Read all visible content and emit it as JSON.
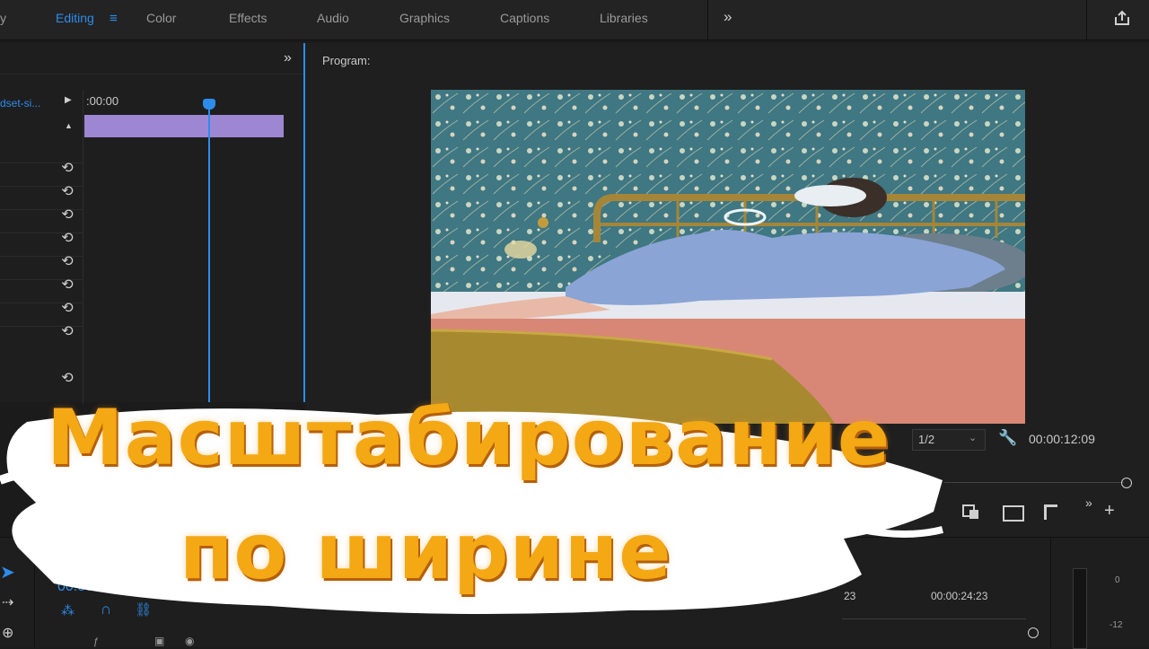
{
  "workspaces": {
    "partial_left": "y",
    "tabs": [
      "Editing",
      "Color",
      "Effects",
      "Audio",
      "Graphics",
      "Captions",
      "Libraries"
    ],
    "active": "Editing",
    "more": "»"
  },
  "effect_controls": {
    "clip_name": "dset-si...",
    "time_start": ":00:00"
  },
  "program": {
    "title": "Program:",
    "resolution": "1/2",
    "timecode": "00:00:12:09"
  },
  "timeline": {
    "playhead": "00:00:",
    "ruler_a": "23",
    "ruler_b": "00:00:24:23"
  },
  "audio_meter": {
    "db_top": "0",
    "db_mid": "-12"
  },
  "overlay": {
    "line1": "Масштабирование",
    "line2": "по ширине"
  },
  "colors": {
    "accent": "#2d8ceb",
    "clip": "#9d86d2",
    "title_text": "#f4a814"
  }
}
